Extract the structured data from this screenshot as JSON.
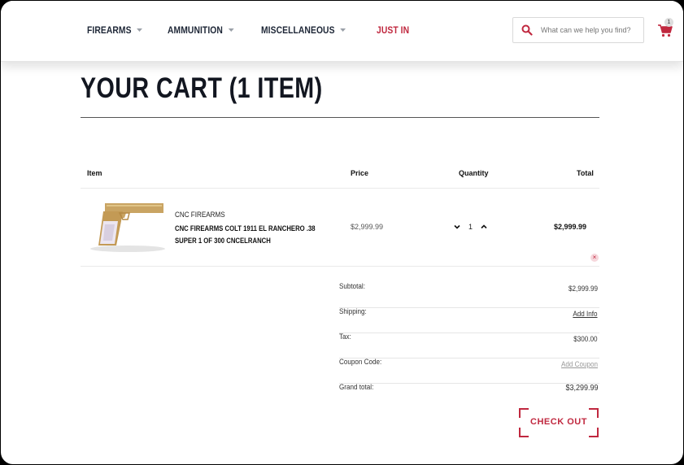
{
  "nav": {
    "items": [
      {
        "label": "FIREARMS"
      },
      {
        "label": "AMMUNITION"
      },
      {
        "label": "MISCELLANEOUS"
      },
      {
        "label": "JUST IN"
      }
    ]
  },
  "search": {
    "placeholder": "What can we help you find?"
  },
  "cart": {
    "count": "1"
  },
  "page": {
    "title": "YOUR CART (1 ITEM)"
  },
  "table": {
    "headers": {
      "item": "Item",
      "price": "Price",
      "quantity": "Quantity",
      "total": "Total"
    },
    "rows": [
      {
        "brand": "CNC FIREARMS",
        "name": "CNC FIREARMS COLT 1911 EL RANCHERO .38 SUPER 1 OF 300 CNCELRANCH",
        "price": "$2,999.99",
        "quantity": "1",
        "total": "$2,999.99"
      }
    ]
  },
  "summary": {
    "subtotal_label": "Subtotal:",
    "subtotal": "$2,999.99",
    "shipping_label": "Shipping:",
    "shipping": "Add Info",
    "tax_label": "Tax:",
    "tax": "$300.00",
    "coupon_label": "Coupon Code:",
    "coupon": "Add Coupon",
    "grand_label": "Grand total:",
    "grand": "$3,299.99"
  },
  "checkout": {
    "label": "CHECK OUT"
  },
  "colors": {
    "accent": "#c0283f",
    "nav_text": "#1d2636"
  }
}
